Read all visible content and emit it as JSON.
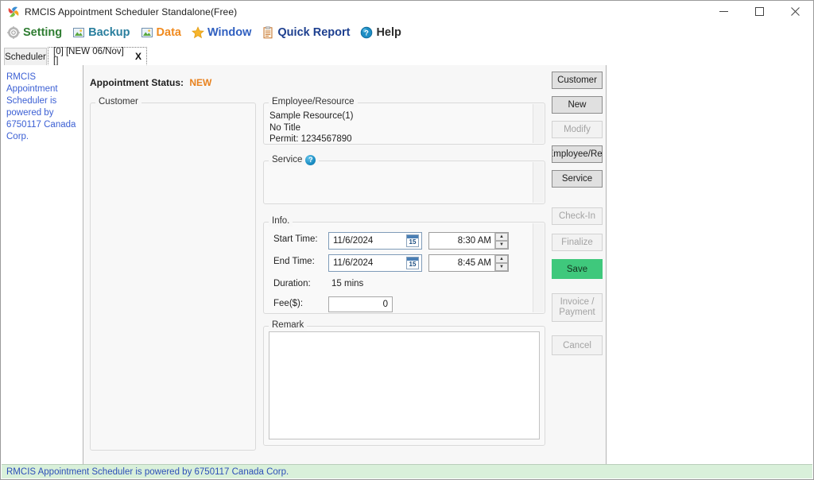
{
  "window": {
    "title": "RMCIS Appointment Scheduler Standalone(Free)",
    "icon": "app-pinwheel-icon",
    "minimize": "—",
    "maximize": "☐",
    "close": "✕"
  },
  "menubar": {
    "items": [
      {
        "label": "Setting",
        "color": "#2f7d32",
        "icon": "gear-icon"
      },
      {
        "label": "Backup",
        "color": "#2a7f9e",
        "icon": "backup-image-icon"
      },
      {
        "label": "Data",
        "color": "#f08a1e",
        "icon": "data-image-icon"
      },
      {
        "label": "Window",
        "color": "#2f5fc0",
        "icon": "star-icon"
      },
      {
        "label": "Quick Report",
        "color": "#1d3f8f",
        "icon": "clipboard-icon"
      },
      {
        "label": "Help",
        "color": "#2d2d2d",
        "icon": "question-circle-icon"
      }
    ]
  },
  "tabs": {
    "inactive_label": "Scheduler",
    "active_label": "[0] [NEW 06/Nov] []",
    "active_close": "X"
  },
  "sidebar": {
    "promo": "RMCIS Appointment Scheduler is powered by 6750117 Canada Corp."
  },
  "form": {
    "status_label": "Appointment Status:",
    "status_value": "NEW",
    "customer": {
      "title": "Customer"
    },
    "employee": {
      "title": "Employee/Resource",
      "line1": "Sample Resource(1)",
      "line2": "No Title",
      "line3": "Permit: 1234567890"
    },
    "service": {
      "title": "Service",
      "help": "?"
    },
    "info": {
      "title": "Info.",
      "start_label": "Start Time:",
      "start_date": "11/6/2024",
      "start_time": "8:30 AM",
      "end_label": "End Time:",
      "end_date": "11/6/2024",
      "end_time": "8:45 AM",
      "duration_label": "Duration:",
      "duration_value": "15 mins",
      "fee_label": "Fee($):",
      "fee_value": "0",
      "calendar_day": "15",
      "spin_up": "▲",
      "spin_down": "▼"
    },
    "remark": {
      "title": "Remark",
      "value": ""
    }
  },
  "buttons": [
    {
      "name": "customer",
      "label": "Customer",
      "state": "enabled"
    },
    {
      "name": "new",
      "label": "New",
      "state": "enabled"
    },
    {
      "name": "modify",
      "label": "Modify",
      "state": "disabled"
    },
    {
      "name": "employee-resource",
      "label": "Employee/Res",
      "state": "enabled"
    },
    {
      "name": "service",
      "label": "Service",
      "state": "enabled"
    },
    {
      "name": "check-in",
      "label": "Check-In",
      "state": "disabled"
    },
    {
      "name": "finalize",
      "label": "Finalize",
      "state": "disabled"
    },
    {
      "name": "save",
      "label": "Save",
      "state": "primary"
    },
    {
      "name": "invoice-payment",
      "label1": "Invoice /",
      "label2": "Payment",
      "state": "disabled"
    },
    {
      "name": "cancel",
      "label": "Cancel",
      "state": "disabled"
    }
  ],
  "statusbar": {
    "text": "RMCIS Appointment Scheduler is powered by 6750117 Canada Corp."
  },
  "colors": {
    "accent_green": "#3fc87c",
    "status_orange": "#e8821e",
    "link_blue": "#3b5fd4",
    "statusbar_bg": "#d9f0da"
  }
}
